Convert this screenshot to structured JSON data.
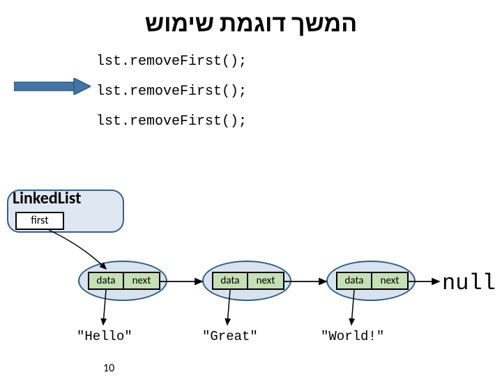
{
  "title": "המשך דוגמת שימוש",
  "code": {
    "line1": "lst.removeFirst();",
    "line2": "lst.removeFirst();",
    "line3": "lst.removeFirst();"
  },
  "linkedList": {
    "classLabel": "LinkedList",
    "firstLabel": "first"
  },
  "nodes": [
    {
      "dataLabel": "data",
      "nextLabel": "next",
      "value": "\"Hello\""
    },
    {
      "dataLabel": "data",
      "nextLabel": "next",
      "value": "\"Great\""
    },
    {
      "dataLabel": "data",
      "nextLabel": "next",
      "value": "\"World!\""
    }
  ],
  "nullLabel": "null",
  "slideNumber": "10"
}
